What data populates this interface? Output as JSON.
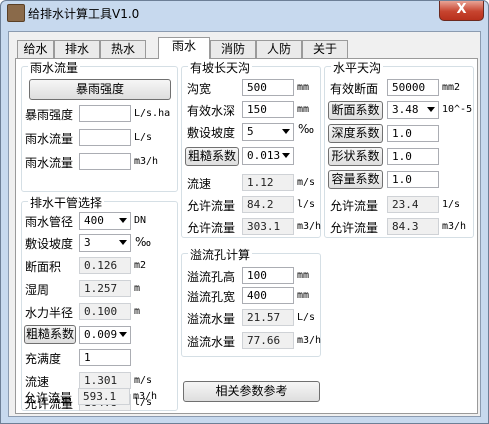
{
  "window": {
    "title": "给排水计算工具V1.0",
    "close": "X"
  },
  "tabs": [
    "给水",
    "排水",
    "热水",
    "雨水",
    "消防",
    "人防",
    "关于"
  ],
  "rain_flow": {
    "title": "雨水流量",
    "button": "暴雨强度",
    "rows": [
      {
        "label": "暴雨强度",
        "value": "",
        "unit": "L/s.ha"
      },
      {
        "label": "雨水流量",
        "value": "",
        "unit": "L/s"
      },
      {
        "label": "雨水流量",
        "value": "",
        "unit": "m3/h"
      }
    ]
  },
  "main_pipe": {
    "title": "排水干管选择",
    "pipe_label": "雨水管径",
    "pipe_value": "400",
    "pipe_unit": "DN",
    "slope_label": "敷设坡度",
    "slope_value": "3",
    "slope_unit": "‰",
    "area_label": "断面积",
    "area_value": "0.126",
    "area_unit": "m2",
    "perimeter_label": "湿周",
    "perimeter_value": "1.257",
    "perimeter_unit": "m",
    "radius_label": "水力半径",
    "radius_value": "0.100",
    "radius_unit": "m",
    "rough_button": "粗糙系数",
    "rough_value": "0.009",
    "fill_label": "充满度",
    "fill_value": "1",
    "velocity_label": "流速",
    "velocity_value": "1.301",
    "velocity_unit": "m/s",
    "flow1_label": "允许流量",
    "flow1_value": "164.8",
    "flow1_unit": "l/s",
    "flow2_label": "允许流量",
    "flow2_value": "593.1",
    "flow2_unit": "m3/h"
  },
  "slope_gutter": {
    "title": "有坡长天沟",
    "width_label": "沟宽",
    "width_value": "500",
    "width_unit": "mm",
    "depth_label": "有效水深",
    "depth_value": "150",
    "depth_unit": "mm",
    "slope_label": "敷设坡度",
    "slope_value": "5",
    "slope_unit": "‰",
    "rough_button": "粗糙系数",
    "rough_value": "0.013",
    "velocity_label": "流速",
    "velocity_value": "1.12",
    "velocity_unit": "m/s",
    "flow1_label": "允许流量",
    "flow1_value": "84.2",
    "flow1_unit": "l/s",
    "flow2_label": "允许流量",
    "flow2_value": "303.1",
    "flow2_unit": "m3/h"
  },
  "flat_gutter": {
    "title": "水平天沟",
    "section_label": "有效断面",
    "section_value": "50000",
    "section_unit": "mm2",
    "section_btn": "断面系数",
    "section_coef": "3.48",
    "section_coef_unit": "10^-5",
    "depth_btn": "深度系数",
    "depth_coef": "1.0",
    "shape_btn": "形状系数",
    "shape_coef": "1.0",
    "capacity_btn": "容量系数",
    "capacity_coef": "1.0",
    "flow1_label": "允许流量",
    "flow1_value": "23.4",
    "flow1_unit": "1/s",
    "flow2_label": "允许流量",
    "flow2_value": "84.3",
    "flow2_unit": "m3/h"
  },
  "overflow": {
    "title": "溢流孔计算",
    "height_label": "溢流孔高",
    "height_value": "100",
    "height_unit": "mm",
    "width_label": "溢流孔宽",
    "width_value": "400",
    "width_unit": "mm",
    "flow1_label": "溢流水量",
    "flow1_value": "21.57",
    "flow1_unit": "L/s",
    "flow2_label": "溢流水量",
    "flow2_value": "77.66",
    "flow2_unit": "m3/h"
  },
  "reference_button": "相关参数参考",
  "colors": {
    "frame": "#c7d9ee",
    "close": "#c7442f",
    "group_border": "#d5dfe5"
  }
}
